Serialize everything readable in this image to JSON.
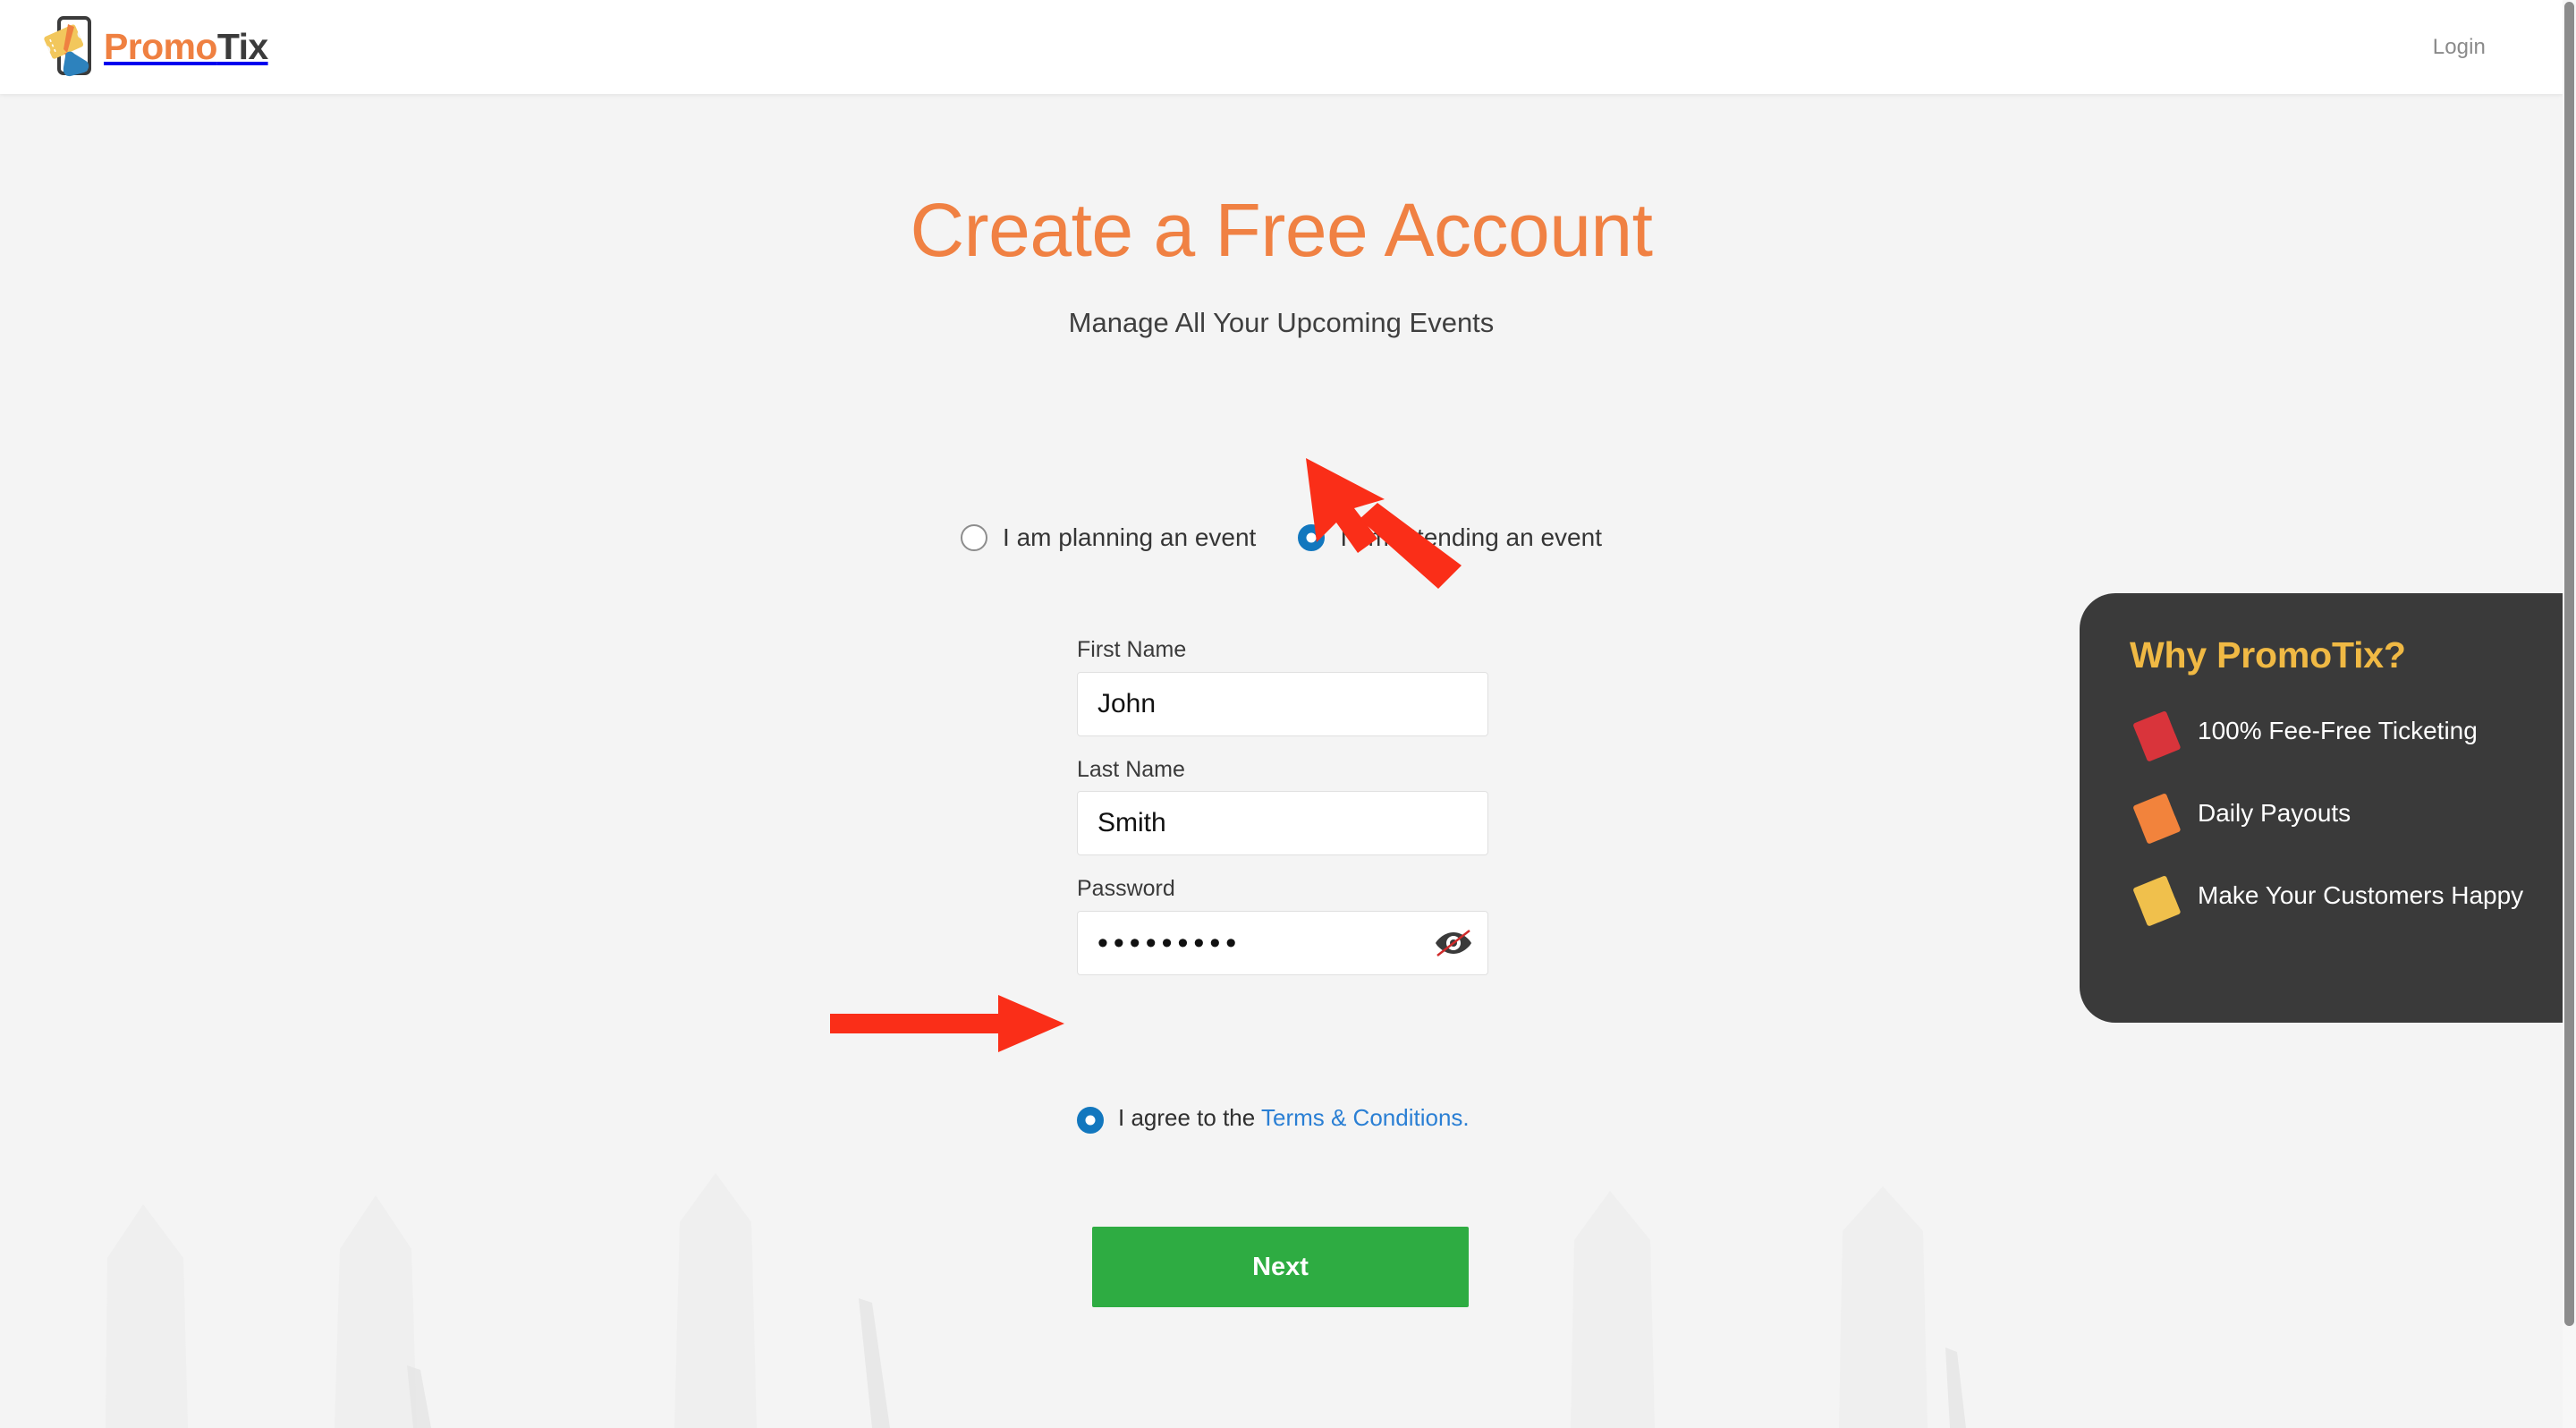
{
  "header": {
    "brand_promo": "Promo",
    "brand_tix": "Tix",
    "logo_icon": "promotix-phone-ticket-logo",
    "login_label": "Login"
  },
  "main": {
    "title": "Create a Free Account",
    "subtitle": "Manage All Your Upcoming Events",
    "role_options": [
      {
        "label": "I am planning an event",
        "checked": false
      },
      {
        "label": "I am attending an event",
        "checked": true
      }
    ],
    "fields": [
      {
        "label": "First Name",
        "value": "John",
        "placeholder": "First Name",
        "type": "text"
      },
      {
        "label": "Last Name",
        "value": "Smith",
        "placeholder": "Last Name",
        "type": "text"
      }
    ],
    "password": {
      "label": "Password",
      "masked_value": "•••••••••",
      "placeholder": "Password",
      "toggle_icon": "eye-slash-icon"
    },
    "terms": {
      "checked": true,
      "prefix": "I agree to the ",
      "link_label": "Terms & Conditions."
    },
    "submit_label": "Next"
  },
  "why_panel": {
    "title": "Why PromoTix?",
    "items": [
      {
        "text": "100% Fee-Free Ticketing",
        "icon": "ticket-icon",
        "color": "#d9343b"
      },
      {
        "text": "Daily Payouts",
        "icon": "ticket-icon",
        "color": "#f2833c"
      },
      {
        "text": "Make Your Customers Happy",
        "icon": "ticket-icon",
        "color": "#f0c04c"
      }
    ]
  },
  "annotations": [
    {
      "name": "arrow-pointing-at-attending-radio",
      "icon": "red-cursor-arrow",
      "color": "#fa2e18"
    },
    {
      "name": "arrow-pointing-at-terms-radio",
      "icon": "red-right-arrow",
      "color": "#fa2e18"
    }
  ],
  "colors": {
    "accent_orange": "#f08143",
    "brand_dark": "#3b3b3b",
    "radio_blue": "#1277be",
    "link_blue": "#2a7fd4",
    "button_green": "#2eac42",
    "panel_dark": "#3a3a3a",
    "panel_title_yellow": "#f0b944",
    "page_bg": "#f4f4f4",
    "annotation_red": "#fa2e18"
  }
}
